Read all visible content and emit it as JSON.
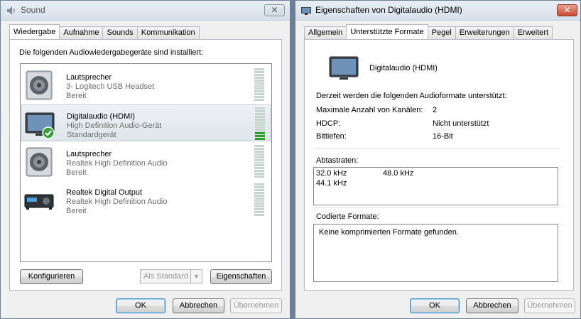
{
  "sound_window": {
    "title": "Sound",
    "close_label": "✕",
    "tabs": [
      "Wiedergabe",
      "Aufnahme",
      "Sounds",
      "Kommunikation"
    ],
    "heading": "Die folgenden Audiowiedergabegeräte sind installiert:",
    "devices": [
      {
        "name": "Lautsprecher",
        "description": "3- Logitech USB Headset",
        "status": "Bereit",
        "icon": "speaker-icon",
        "level": 0
      },
      {
        "name": "Digitalaudio (HDMI)",
        "description": "High Definition Audio-Gerät",
        "status": "Standardgerät",
        "icon": "monitor-icon",
        "level": 0.25,
        "default": true
      },
      {
        "name": "Lautsprecher",
        "description": "Realtek High Definition Audio",
        "status": "Bereit",
        "icon": "speaker-icon",
        "level": 0
      },
      {
        "name": "Realtek Digital Output",
        "description": "Realtek High Definition Audio",
        "status": "Bereit",
        "icon": "receiver-icon",
        "level": 0
      }
    ],
    "configure_label": "Konfigurieren",
    "set_default_label": "Als Standard",
    "properties_label": "Eigenschaften",
    "ok_label": "OK",
    "cancel_label": "Abbrechen",
    "apply_label": "Übernehmen"
  },
  "props_window": {
    "title": "Eigenschaften von Digitalaudio (HDMI)",
    "close_label": "✕",
    "tabs": [
      "Allgemein",
      "Unterstützte Formate",
      "Pegel",
      "Erweiterungen",
      "Erweitert"
    ],
    "device_name": "Digitalaudio (HDMI)",
    "intro": "Derzeit werden die folgenden Audioformate unterstützt:",
    "props": [
      {
        "label": "Maximale Anzahl von Kanälen:",
        "value": "2"
      },
      {
        "label": "HDCP:",
        "value": "Nicht unterstützt"
      },
      {
        "label": "Bittiefen:",
        "value": "16-Bit"
      }
    ],
    "sample_rates_label": "Abtastraten:",
    "sample_rates": [
      "32.0 kHz",
      "48.0 kHz",
      "44.1 kHz"
    ],
    "encoded_label": "Codierte Formate:",
    "encoded_text": "Keine komprimierten Formate gefunden.",
    "ok_label": "OK",
    "cancel_label": "Abbrechen",
    "apply_label": "Übernehmen"
  },
  "colors": {
    "selection": "#dfe5eb",
    "meter_on": "#2aa02a",
    "default_check": "#39a13a"
  }
}
